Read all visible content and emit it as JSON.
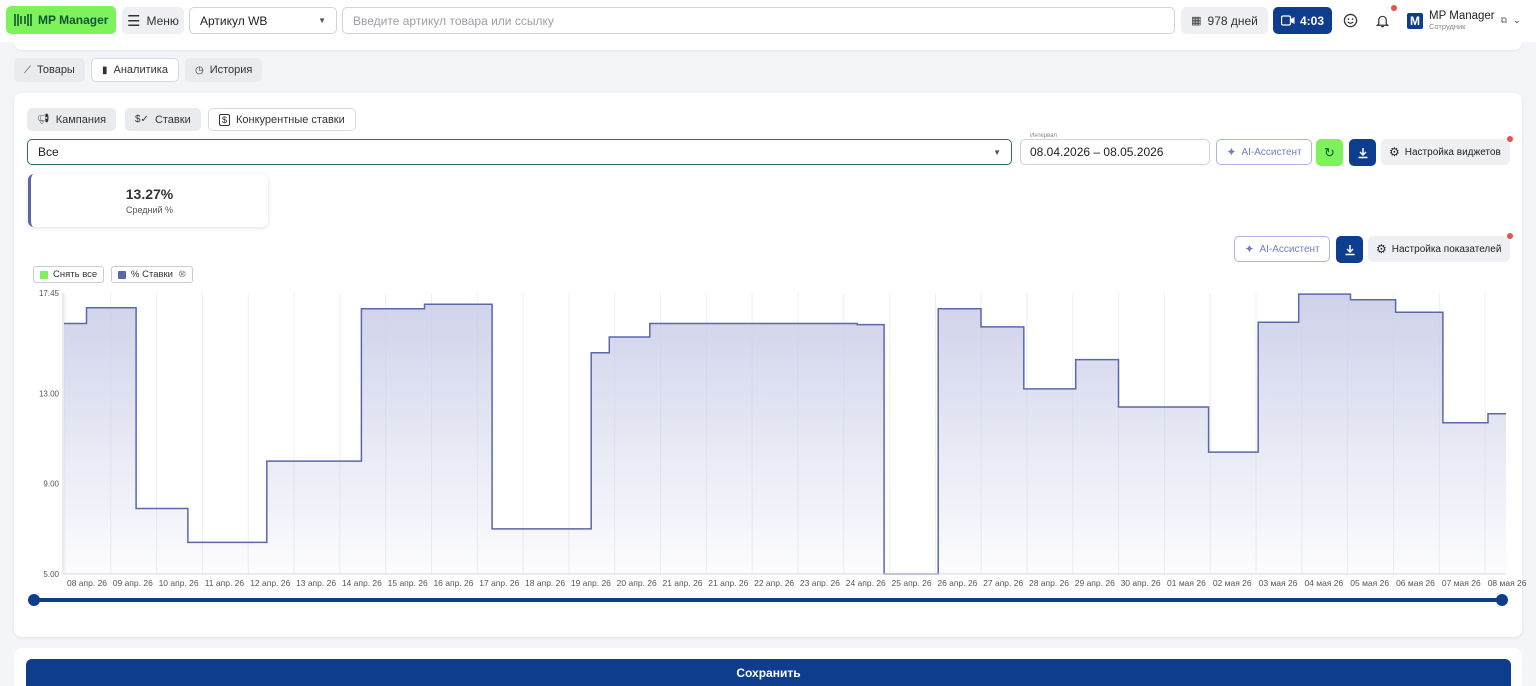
{
  "topbar": {
    "logo": "MP Manager",
    "menu": "Меню",
    "artikul_select": "Артикул WB",
    "search_placeholder": "Введите артикул товара или ссылку",
    "days": "978 дней",
    "timer": "4:03",
    "user_name": "MP Manager",
    "user_role": "Сотрудник"
  },
  "tabs": [
    {
      "label": "Товары",
      "icon": "line-chart-icon"
    },
    {
      "label": "Аналитика",
      "icon": "bar-chart-icon",
      "active": true
    },
    {
      "label": "История",
      "icon": "history-icon"
    }
  ],
  "subtabs": [
    {
      "label": "Кампания",
      "icon": "megaphone-icon"
    },
    {
      "label": "Ставки",
      "icon": "bid-icon"
    },
    {
      "label": "Конкурентные ставки",
      "icon": "competitor-icon",
      "active": true
    }
  ],
  "filters": {
    "campaign_value": "Все",
    "interval_label": "Интервал",
    "interval_value": "08.04.2026 – 08.05.2026",
    "ai_assistant": "AI-Ассистент",
    "widget_settings": "Настройка виджетов",
    "metrics_settings": "Настройка показателей"
  },
  "stat": {
    "value": "13.27%",
    "label": "Средний %"
  },
  "legend": {
    "deselect_all": "Снять все",
    "series_name": "% Ставки"
  },
  "colors": {
    "accent": "#0e3d8e",
    "green": "#7ef25a",
    "series": "#5a68a8"
  },
  "chart_data": {
    "type": "area",
    "step": true,
    "ylim": [
      5.0,
      17.45
    ],
    "yticks": [
      "17.45",
      "13.00",
      "9.00",
      "5.00"
    ],
    "xticks": [
      "08 апр. 26",
      "09 апр. 26",
      "10 апр. 26",
      "11 апр. 26",
      "12 апр. 26",
      "13 апр. 26",
      "14 апр. 26",
      "15 апр. 26",
      "16 апр. 26",
      "17 апр. 26",
      "18 апр. 26",
      "19 апр. 26",
      "20 апр. 26",
      "21 апр. 26",
      "21 апр. 26",
      "22 апр. 26",
      "23 апр. 26",
      "24 апр. 26",
      "25 апр. 26",
      "26 апр. 26",
      "27 апр. 26",
      "28 апр. 26",
      "29 апр. 26",
      "30 апр. 26",
      "01 мая 26",
      "02 мая 26",
      "03 мая 26",
      "04 мая 26",
      "05 мая 26",
      "06 мая 26",
      "07 мая 26",
      "08 мая 26"
    ],
    "series": [
      {
        "name": "% Ставки",
        "points": [
          [
            0.0,
            16.1
          ],
          [
            0.5,
            16.1
          ],
          [
            0.5,
            16.8
          ],
          [
            1.6,
            16.8
          ],
          [
            1.6,
            7.9
          ],
          [
            2.75,
            7.9
          ],
          [
            2.75,
            6.4
          ],
          [
            4.5,
            6.4
          ],
          [
            4.5,
            10.0
          ],
          [
            6.6,
            10.0
          ],
          [
            6.6,
            16.75
          ],
          [
            8.0,
            16.75
          ],
          [
            8.0,
            16.95
          ],
          [
            9.5,
            16.95
          ],
          [
            9.5,
            7.0
          ],
          [
            11.7,
            7.0
          ],
          [
            11.7,
            14.8
          ],
          [
            12.1,
            14.8
          ],
          [
            12.1,
            15.5
          ],
          [
            13.0,
            15.5
          ],
          [
            13.0,
            16.1
          ],
          [
            17.6,
            16.1
          ],
          [
            17.6,
            16.05
          ],
          [
            18.2,
            16.05
          ],
          [
            18.2,
            5.0
          ],
          [
            19.4,
            5.0
          ],
          [
            19.4,
            16.75
          ],
          [
            20.35,
            16.75
          ],
          [
            20.35,
            15.95
          ],
          [
            21.3,
            15.95
          ],
          [
            21.3,
            13.2
          ],
          [
            22.45,
            13.2
          ],
          [
            22.45,
            14.5
          ],
          [
            23.4,
            14.5
          ],
          [
            23.4,
            12.4
          ],
          [
            25.4,
            12.4
          ],
          [
            25.4,
            10.4
          ],
          [
            26.5,
            10.4
          ],
          [
            26.5,
            16.15
          ],
          [
            27.4,
            16.15
          ],
          [
            27.4,
            17.4
          ],
          [
            28.55,
            17.4
          ],
          [
            28.55,
            17.15
          ],
          [
            29.55,
            17.15
          ],
          [
            29.55,
            16.6
          ],
          [
            30.6,
            16.6
          ],
          [
            30.6,
            11.7
          ],
          [
            31.6,
            11.7
          ],
          [
            31.6,
            12.1
          ],
          [
            32.0,
            12.1
          ]
        ]
      }
    ]
  }
}
